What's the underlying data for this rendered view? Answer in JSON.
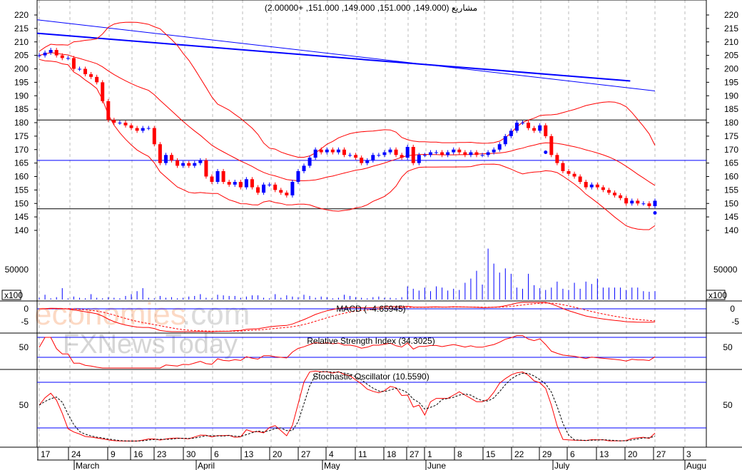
{
  "chart_data": {
    "type": "candlestick",
    "title": "مشاريع (149.000, 151.000, 149.000, 151.000, +2.00000)",
    "price_axis": {
      "ticks": [
        220,
        215,
        210,
        205,
        200,
        195,
        190,
        185,
        180,
        175,
        170,
        165,
        160,
        155,
        150,
        145,
        140
      ],
      "ylim": [
        138,
        221
      ]
    },
    "closes": [
      205,
      206,
      207,
      205,
      204,
      204,
      200,
      200,
      198,
      197,
      195,
      188,
      181,
      180,
      180,
      179,
      178,
      177,
      178,
      178,
      172,
      165,
      168,
      166,
      164,
      165,
      164,
      165,
      166,
      160,
      158,
      162,
      158,
      157,
      158,
      156,
      159,
      156,
      154,
      157,
      157,
      155,
      154,
      153,
      158,
      162,
      164,
      167,
      170,
      169,
      170,
      169,
      170,
      168,
      168,
      167,
      165,
      166,
      168,
      168,
      169,
      170,
      168,
      167,
      171,
      165,
      168,
      168,
      169,
      169,
      168,
      169,
      170,
      169,
      168,
      169,
      168,
      168,
      169,
      170,
      172,
      175,
      177,
      180,
      180,
      178,
      177,
      179,
      175,
      168,
      165,
      162,
      161,
      160,
      158,
      156,
      157,
      156,
      155,
      154,
      153,
      152,
      150,
      151,
      150,
      150,
      149,
      151
    ],
    "volume": {
      "unit_label": "x100",
      "tick": "50000",
      "values": [
        3000,
        8000,
        2000,
        4000,
        19000,
        2000,
        5000,
        3000,
        2000,
        9000,
        3000,
        2000,
        4000,
        3000,
        2000,
        6000,
        9000,
        14000,
        19000,
        3000,
        2000,
        6000,
        3000,
        4000,
        2000,
        3000,
        5000,
        6000,
        9000,
        3000,
        2000,
        8000,
        7000,
        6000,
        6000,
        3000,
        5000,
        7000,
        7000,
        3000,
        2000,
        9000,
        3000,
        7000,
        5000,
        4000,
        8000,
        6000,
        3000,
        5000,
        4000,
        2000,
        3000,
        8000,
        6000,
        4000,
        3000,
        2000,
        4000,
        5000,
        3000,
        3000,
        2000,
        4000,
        22000,
        18000,
        15000,
        20000,
        14000,
        22000,
        20000,
        15000,
        18000,
        16000,
        28000,
        35000,
        48000,
        25000,
        85000,
        60000,
        45000,
        52000,
        43000,
        20000,
        18000,
        43000,
        24000,
        19000,
        16000,
        20000,
        30000,
        18000,
        16000,
        28000,
        18000,
        30000,
        26000,
        35000,
        20000,
        20000,
        20000,
        20000,
        16000,
        20000,
        20000,
        14000,
        13000,
        14000
      ]
    },
    "horizontal_lines": [
      {
        "value": 181,
        "color": "#000000"
      },
      {
        "value": 166,
        "color": "#0000ff"
      },
      {
        "value": 148,
        "color": "#000000"
      }
    ],
    "trend_lines": [
      {
        "from": 213.2,
        "to": 195.5,
        "end_fraction": 0.96,
        "color": "#0000ff",
        "width": 2
      },
      {
        "from": 218.2,
        "to": 191.8,
        "end_fraction": 1.0,
        "color": "#0000ff",
        "width": 1
      }
    ],
    "markers": [
      {
        "index": 88,
        "value": 169
      },
      {
        "index": 107,
        "value": 146.5
      }
    ],
    "indicators": {
      "macd": {
        "label": "MACD ( -4.65945)",
        "ticks": [
          "0",
          "-5"
        ]
      },
      "rsi": {
        "label": "Relative Strength Index (34.3025)",
        "ticks": [
          "50"
        ]
      },
      "stoch": {
        "label": "Stochastic Oscillator (10.5590)",
        "ticks": [
          "50"
        ]
      }
    },
    "x_axis": {
      "day_ticks": [
        "17",
        "24",
        "9",
        "16",
        "23",
        "30",
        "6",
        "13",
        "20",
        "27",
        "4",
        "11",
        "18",
        "27",
        "1",
        "8",
        "15",
        "22",
        "29",
        "6",
        "13",
        "20",
        "27",
        "3"
      ],
      "months": [
        "March",
        "April",
        "May",
        "June",
        "July",
        "Augu"
      ]
    },
    "colors": {
      "up": "#0000ff",
      "down": "#ff0000",
      "band": "#ff0000",
      "grid": "#bbbbbb"
    }
  },
  "watermark": {
    "line1a": "economies",
    "line1b": ".com",
    "line2": "FXNewsToday"
  }
}
